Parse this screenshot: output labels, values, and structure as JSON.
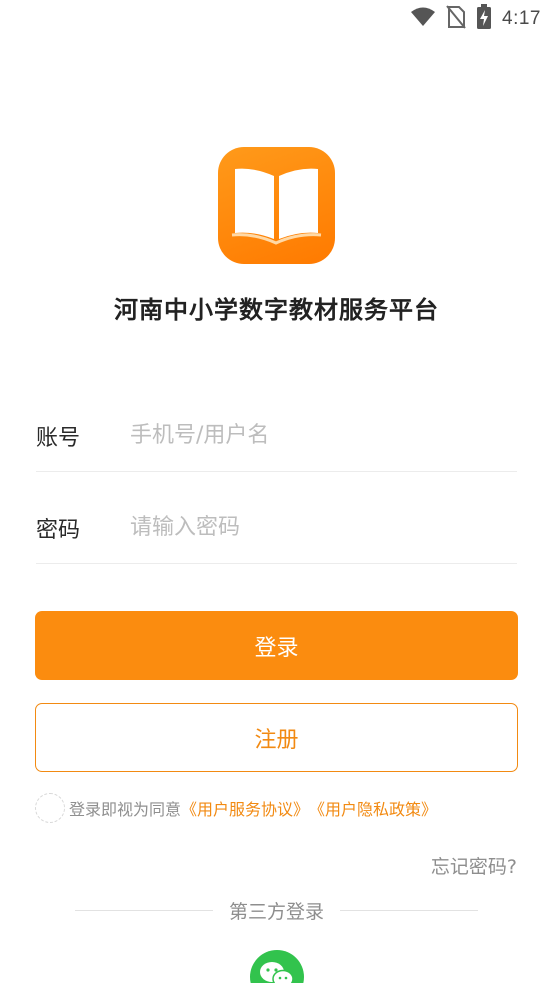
{
  "status_bar": {
    "time": "4:17",
    "icons": [
      "wifi-icon",
      "no-sim-icon",
      "battery-charging-icon"
    ]
  },
  "app": {
    "logo_icon": "open-book-icon",
    "title": "河南中小学数字教材服务平台"
  },
  "form": {
    "account_label": "账号",
    "account_placeholder": "手机号/用户名",
    "account_value": "",
    "password_label": "密码",
    "password_placeholder": "请输入密码",
    "password_value": ""
  },
  "buttons": {
    "login": "登录",
    "register": "注册"
  },
  "agreement": {
    "checked": false,
    "prefix": "登录即视为同意",
    "service_link": "《用户服务协议》",
    "privacy_link": "《用户隐私政策》"
  },
  "forgot_password": "忘记密码?",
  "third_party": {
    "label": "第三方登录",
    "providers": [
      "wechat-icon"
    ]
  },
  "colors": {
    "accent": "#fb8c0f",
    "wechat": "#32c34d"
  }
}
